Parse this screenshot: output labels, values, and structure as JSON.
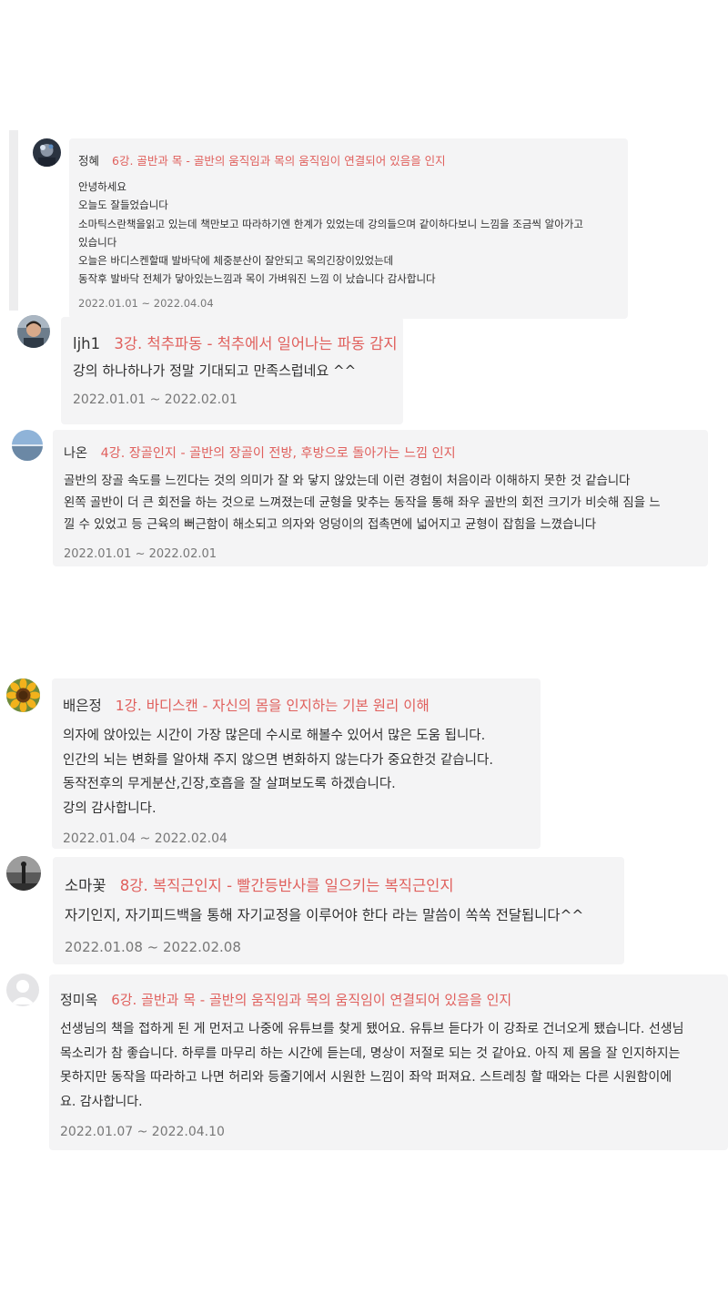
{
  "reviews": [
    {
      "author": "정혜",
      "lecture": "6강. 골반과 목 - 골반의 움직임과 목의 움직임이 연결되어 있음을 인지",
      "lines": [
        "안녕하세요",
        "오늘도 잘들었습니다",
        "소마틱스란책을읽고 있는데 책만보고 따라하기엔 한계가 있었는데 강의들으며 같이하다보니 느낌을 조금씩 알아가고",
        "있습니다",
        "오늘은 바디스켄할때 발바닥에 체중분산이 잘안되고 목의긴장이있었는데",
        "동작후 발바닥 전체가 닿아있는느낌과 목이 가벼워진 느낌 이 났습니다 감사합니다"
      ],
      "period": "2022.01.01 ~ 2022.04.04",
      "avatar_icon": "profile-photo-icon"
    },
    {
      "author": "ljh1",
      "lecture": "3강. 척추파동 - 척추에서 일어나는 파동 감지",
      "lines": [
        "강의 하나하나가 정말 기대되고 만족스럽네요 ^^"
      ],
      "period": "2022.01.01 ~ 2022.02.01",
      "avatar_icon": "profile-photo-icon"
    },
    {
      "author": "나온",
      "lecture": "4강. 장골인지 - 골반의 장골이 전방, 후방으로 돌아가는 느낌 인지",
      "lines": [
        "골반의 장골 속도를 느낀다는 것의 의미가 잘 와 닿지 않았는데 이런 경험이 처음이라 이해하지 못한 것 같습니다",
        "왼쪽 골반이 더 큰 회전을 하는 것으로 느껴졌는데 균형을 맞추는 동작을 통해 좌우 골반의 회전 크기가 비슷해 짐을 느",
        "낄 수 있었고 등 근육의 뻐근함이 해소되고 의자와 엉덩이의 접촉면에 넓어지고 균형이 잡힘을 느꼈습니다"
      ],
      "period": "2022.01.01 ~ 2022.02.01",
      "avatar_icon": "profile-photo-icon"
    },
    {
      "author": "배은정",
      "lecture": "1강. 바디스캔 - 자신의 몸을 인지하는 기본 원리 이해",
      "lines": [
        "의자에 앉아있는 시간이 가장 많은데 수시로 해볼수 있어서 많은 도움 됩니다.",
        "인간의 뇌는 변화를 알아채 주지 않으면 변화하지 않는다가 중요한것 같습니다.",
        "동작전후의 무게분산,긴장,호흡을 잘 살펴보도록 하겠습니다.",
        "강의 감사합니다."
      ],
      "period": "2022.01.04 ~ 2022.02.04",
      "avatar_icon": "sunflower-photo-icon"
    },
    {
      "author": "소마꽃",
      "lecture": "8강. 복직근인지 - 빨간등반사를 일으키는 복직근인지",
      "lines": [
        "자기인지, 자기피드백을 통해 자기교정을 이루어야 한다 라는 말씀이 쏙쏙 전달됩니다^^"
      ],
      "period": "2022.01.08 ~ 2022.02.08",
      "avatar_icon": "profile-photo-icon"
    },
    {
      "author": "정미옥",
      "lecture": "6강. 골반과 목 - 골반의 움직임과 목의 움직임이 연결되어 있음을 인지",
      "lines": [
        "선생님의 책을 접하게 된 게 먼저고 나중에 유튜브를 찾게 됐어요. 유튜브 듣다가 이 강좌로 건너오게 됐습니다. 선생님",
        "목소리가 참 좋습니다. 하루를 마무리 하는 시간에 듣는데, 명상이 저절로 되는 것 같아요. 아직 제 몸을 잘 인지하지는",
        "못하지만 동작을 따라하고 나면 허리와 등줄기에서 시원한 느낌이 좌악 퍼져요. 스트레칭 할 때와는 다른 시원함이에",
        "요. 감사합니다."
      ],
      "period": "2022.01.07 ~ 2022.04.10",
      "avatar_icon": "default-user-icon"
    }
  ],
  "colors": {
    "lecture": "#e0605d",
    "bubble": "#f4f4f5",
    "date": "#777777"
  }
}
